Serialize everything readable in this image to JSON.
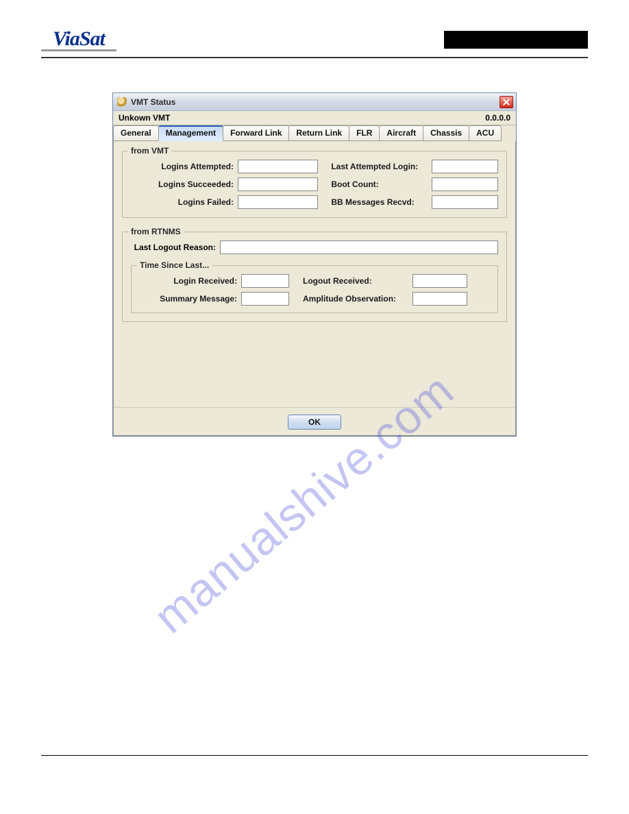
{
  "brand": {
    "logo_text": "ViaSat"
  },
  "dialog": {
    "title": "VMT Status",
    "subtitle_left": "Unkown VMT",
    "subtitle_right": "0.0.0.0",
    "tabs": [
      {
        "label": "General",
        "active": false
      },
      {
        "label": "Management",
        "active": true
      },
      {
        "label": "Forward Link",
        "active": false
      },
      {
        "label": "Return Link",
        "active": false
      },
      {
        "label": "FLR",
        "active": false
      },
      {
        "label": "Aircraft",
        "active": false
      },
      {
        "label": "Chassis",
        "active": false
      },
      {
        "label": "ACU",
        "active": false
      }
    ],
    "from_vmt": {
      "legend": "from VMT",
      "left": [
        {
          "label": "Logins Attempted:",
          "value": ""
        },
        {
          "label": "Logins Succeeded:",
          "value": ""
        },
        {
          "label": "Logins Failed:",
          "value": ""
        }
      ],
      "right": [
        {
          "label": "Last Attempted Login:",
          "value": ""
        },
        {
          "label": "Boot Count:",
          "value": ""
        },
        {
          "label": "BB Messages Recvd:",
          "value": ""
        }
      ]
    },
    "from_rtnms": {
      "legend": "from RTNMS",
      "last_logout_reason": {
        "label": "Last Logout Reason:",
        "value": ""
      },
      "time_since_last": {
        "legend": "Time Since Last...",
        "left": [
          {
            "label": "Login Received:",
            "value": ""
          },
          {
            "label": "Summary Message:",
            "value": ""
          }
        ],
        "right": [
          {
            "label": "Logout Received:",
            "value": ""
          },
          {
            "label": "Amplitude Observation:",
            "value": ""
          }
        ]
      }
    },
    "ok_label": "OK"
  },
  "watermark": "manualshive.com"
}
